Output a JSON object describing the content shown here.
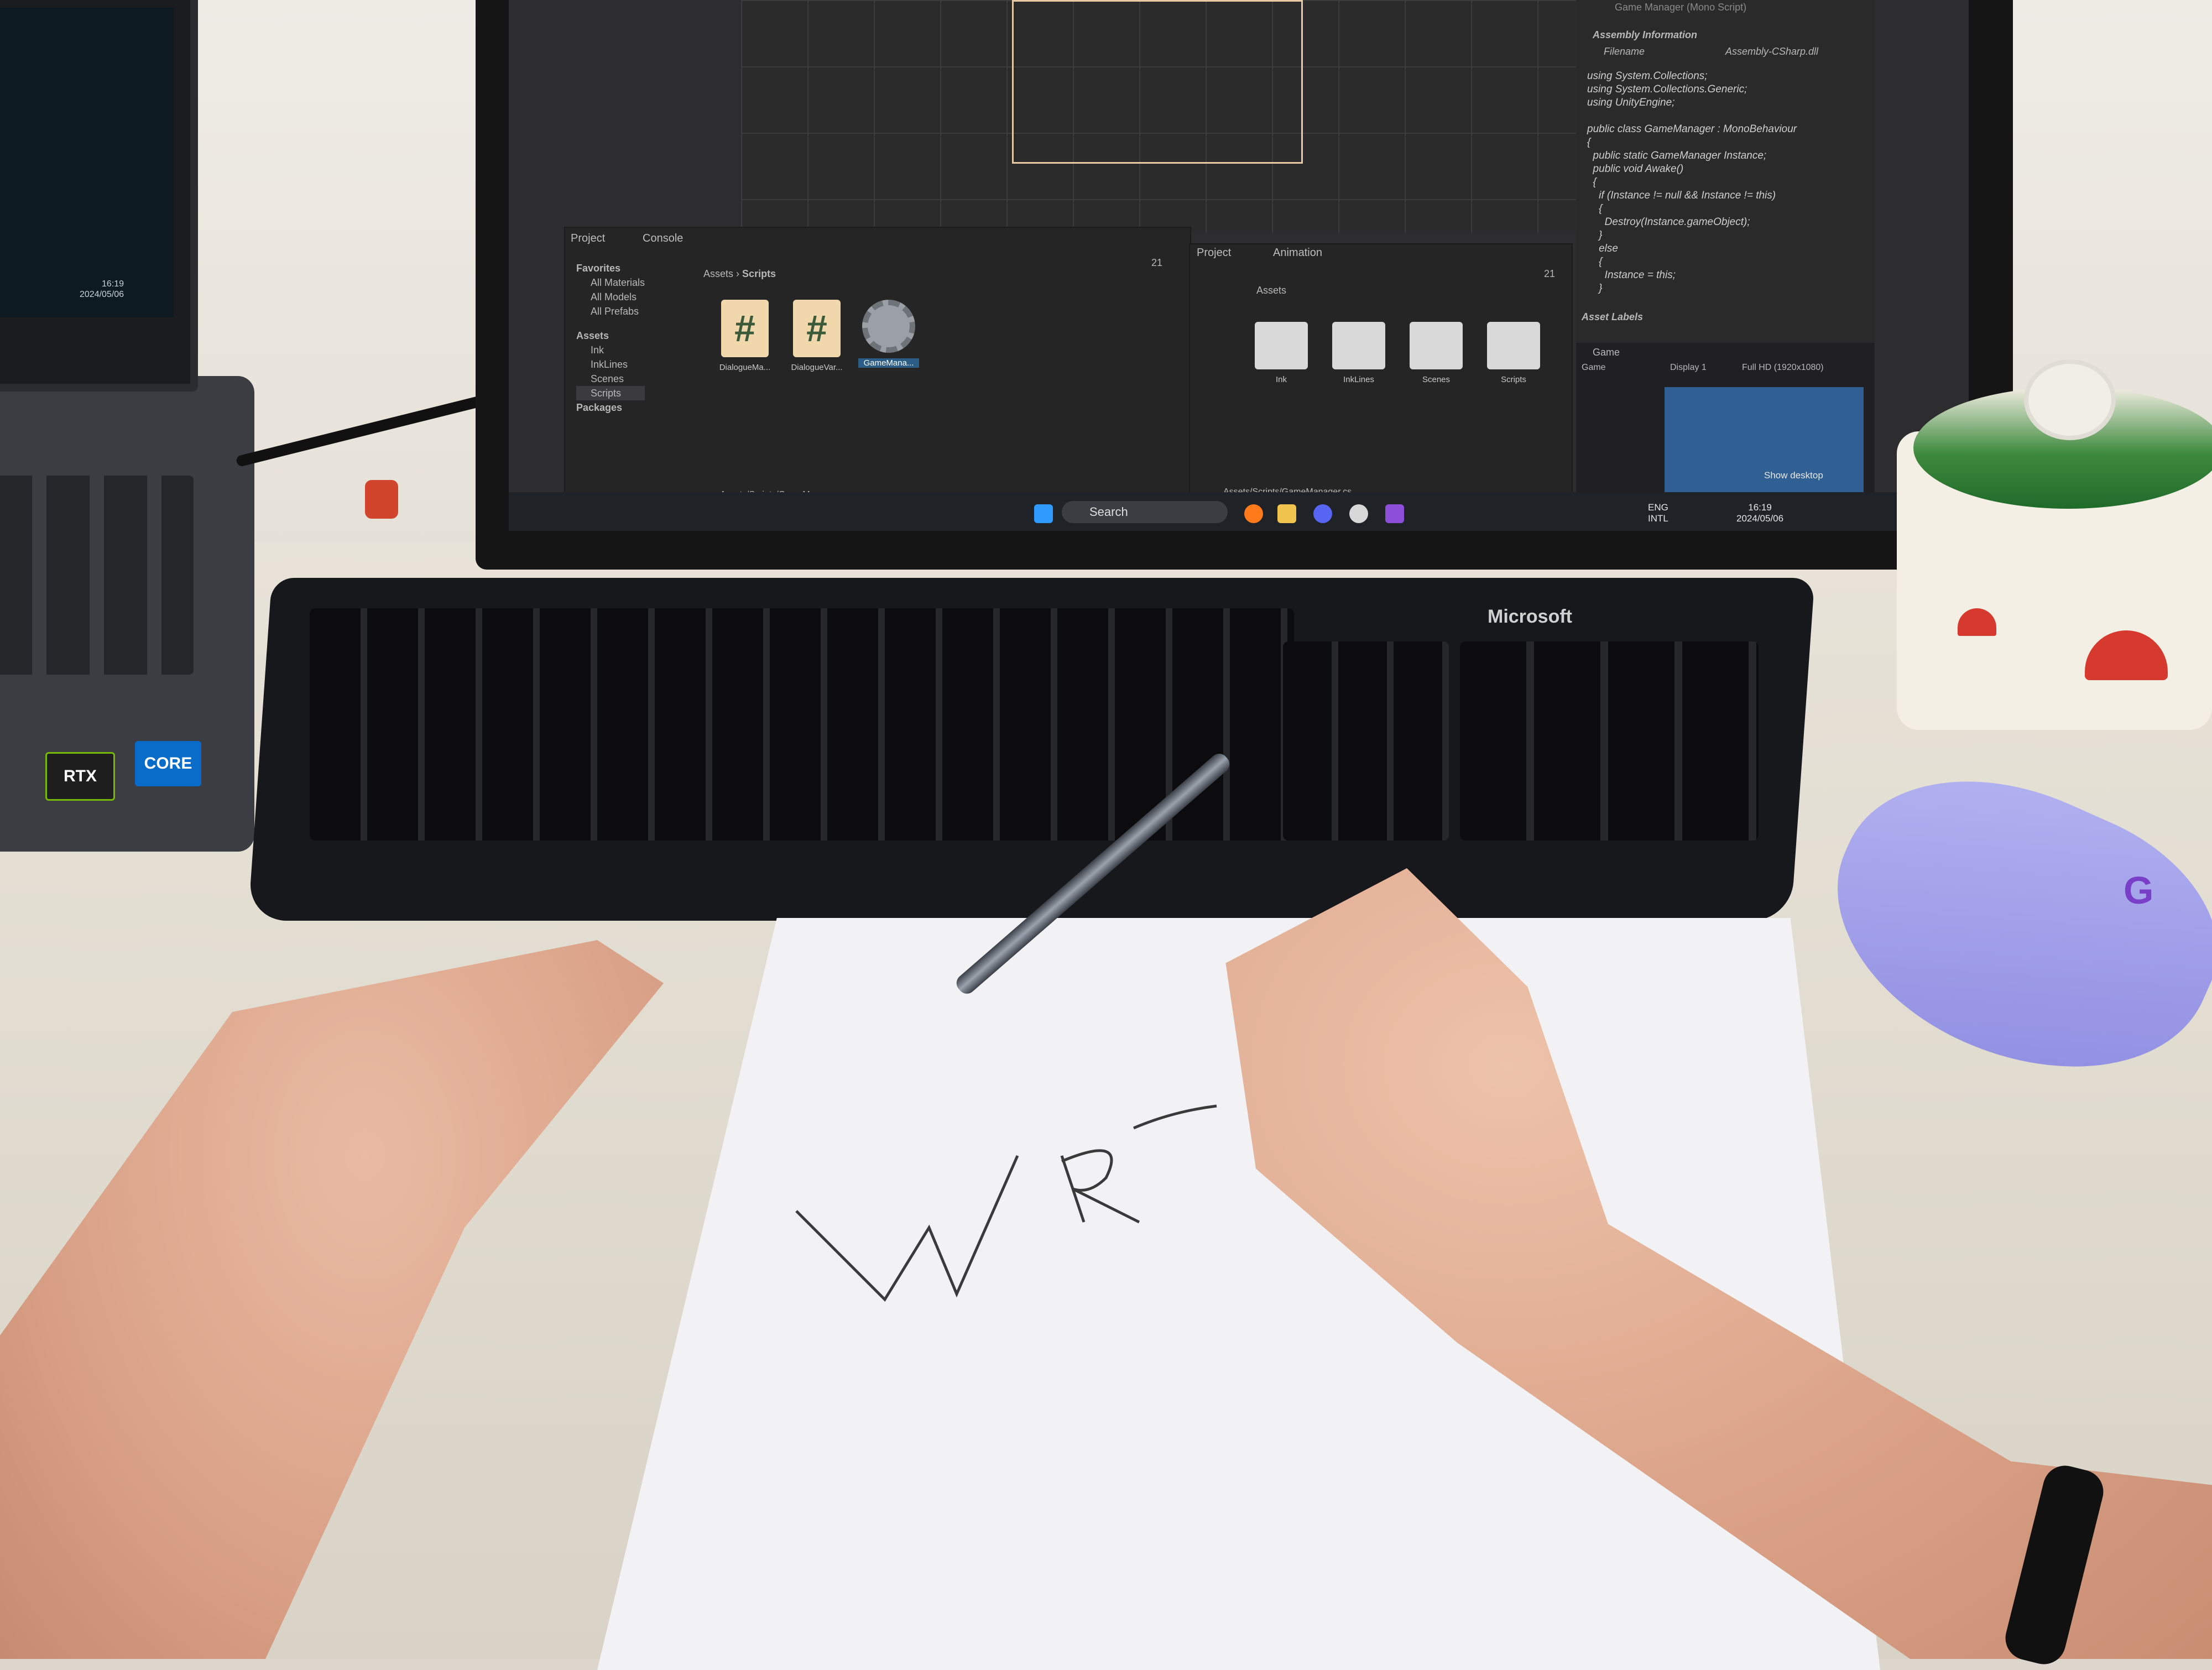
{
  "laptop": {
    "clock_time": "16:19",
    "clock_date": "2024/05/06",
    "sticker_nvidia": "RTX",
    "sticker_intel": "CORE"
  },
  "unity": {
    "left_panel": {
      "tabs": [
        "Project",
        "Console"
      ],
      "favorites_label": "Favorites",
      "favorites": [
        "All Materials",
        "All Models",
        "All Prefabs"
      ],
      "assets_label": "Assets",
      "assets_children": [
        "Ink",
        "InkLines",
        "Scenes",
        "Scripts"
      ],
      "packages_label": "Packages",
      "breadcrumb_root": "Assets",
      "breadcrumb_leaf": "Scripts",
      "items": [
        "DialogueMa...",
        "DialogueVar...",
        "GameMana..."
      ],
      "path": "Assets/Scripts/GameManager.cs",
      "count": "21"
    },
    "right_panel": {
      "tabs": [
        "Project",
        "Animation"
      ],
      "header": "Assets",
      "folders": [
        "Ink",
        "InkLines",
        "Scenes",
        "Scripts"
      ],
      "path": "Assets/Scripts/GameManager.cs",
      "count": "21"
    },
    "inspector": {
      "title": "Game Manager (Mono Script)",
      "section": "Assembly Information",
      "filename_label": "Filename",
      "filename_value": "Assembly-CSharp.dll",
      "code": "using System.Collections;\nusing System.Collections.Generic;\nusing UnityEngine;\n\npublic class GameManager : MonoBehaviour\n{\n  public static GameManager Instance;\n  public void Awake()\n  {\n    if (Instance != null && Instance != this)\n    {\n      Destroy(Instance.gameObject);\n    }\n    else\n    {\n      Instance = this;\n    }",
      "asset_labels": "Asset Labels"
    },
    "game_view": {
      "tab": "Game",
      "mode": "Game",
      "display": "Display 1",
      "resolution": "Full HD (1920x1080)"
    }
  },
  "taskbar": {
    "search_placeholder": "Search",
    "show_desktop": "Show desktop",
    "lang_top": "ENG",
    "lang_bottom": "INTL",
    "time": "16:19",
    "date": "2024/05/06"
  },
  "keyboard": {
    "brand": "Microsoft"
  },
  "paper": {
    "handwriting": "WR"
  },
  "colors": {
    "unity_dark": "#252526",
    "taskbar": "#1f2227",
    "mouse": "#a9a7ee",
    "cs_icon": "#f1d7ac"
  }
}
